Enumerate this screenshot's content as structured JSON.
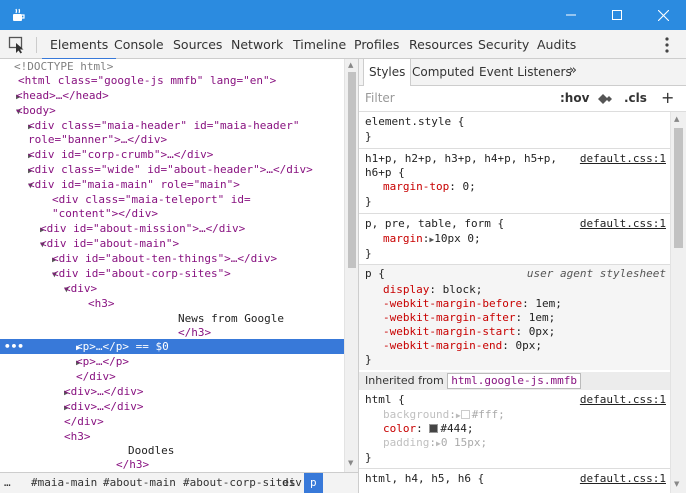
{
  "window": {
    "app_icon": "java-cup-icon",
    "minimize_icon": "minimize-icon",
    "maximize_icon": "maximize-icon",
    "close_icon": "close-icon",
    "titlebar_color": "#2b8be0"
  },
  "toolbar": {
    "tabs": [
      "Elements",
      "Console",
      "Sources",
      "Network",
      "Timeline",
      "Profiles",
      "Resources",
      "Security",
      "Audits"
    ],
    "active_tab": "Elements",
    "accent_color": "#3879d9"
  },
  "elements": {
    "lines": [
      "<!DOCTYPE html>",
      "<html class=\"google-js mmfb\" lang=\"en\">",
      "<head>…</head>",
      "<body>",
      "<div class=\"maia-header\" id=\"maia-header\"",
      "role=\"banner\">…</div>",
      "<div id=\"corp-crumb\">…</div>",
      "<div class=\"wide\" id=\"about-header\">…</div>",
      "<div id=\"maia-main\" role=\"main\">",
      "<div class=\"maia-teleport\" id=",
      "\"content\"></div>",
      "<div id=\"about-mission\">…</div>",
      "<div id=\"about-main\">",
      "<div id=\"about-ten-things\">…</div>",
      "<div id=\"about-corp-sites\">",
      "<div>",
      "<h3>",
      "News from Google",
      "</h3>",
      "<p>…</p> == $0",
      "<p>…</p>",
      "</div>",
      "<div>…</div>",
      "<div>…</div>",
      "</div>",
      "<h3>",
      "Doodles",
      "</h3>"
    ],
    "selected_dots": "•••"
  },
  "breadcrumbs": [
    "…",
    "#maia-main",
    "#about-main",
    "#about-corp-sites",
    "div",
    "p"
  ],
  "styles_pane": {
    "tabs": [
      "Styles",
      "Computed",
      "Event Listeners"
    ],
    "more": "»",
    "filter_placeholder": "Filter",
    "hov": ":hov",
    "cls": ".cls",
    "add": "+",
    "inherited_label": "Inherited from",
    "inherited_tag": "html.google-js.mmfb"
  },
  "rules": {
    "element_style": {
      "selector": "element.style {",
      "close": "}"
    },
    "h_rule": {
      "selector_line1": "h1+p, h2+p, h3+p, h4+p, h5+p,",
      "selector_line2": "h6+p {",
      "source": "default.css:1",
      "prop": "margin-top",
      "value": "0;",
      "close": "}"
    },
    "p_rule": {
      "selector": "p, pre, table, form {",
      "source": "default.css:1",
      "prop": "margin",
      "value": "10px 0;",
      "close": "}"
    },
    "ua_rule": {
      "selector": "p {",
      "source": "user agent stylesheet",
      "props": [
        {
          "name": "display",
          "value": "block;"
        },
        {
          "name": "-webkit-margin-before",
          "value": "1em;"
        },
        {
          "name": "-webkit-margin-after",
          "value": "1em;"
        },
        {
          "name": "-webkit-margin-start",
          "value": "0px;"
        },
        {
          "name": "-webkit-margin-end",
          "value": "0px;"
        }
      ],
      "close": "}"
    },
    "html_rule": {
      "selector": "html {",
      "source": "default.css:1",
      "props": [
        {
          "name": "background",
          "value": "#fff;",
          "swatch": "#ffffff"
        },
        {
          "name": "color",
          "value": "#444;",
          "swatch": "#444444"
        },
        {
          "name": "padding",
          "value": "0 15px;"
        }
      ],
      "close": "}"
    },
    "html_h_rule": {
      "selector": "html, h4, h5, h6 {",
      "source": "default.css:1"
    }
  }
}
